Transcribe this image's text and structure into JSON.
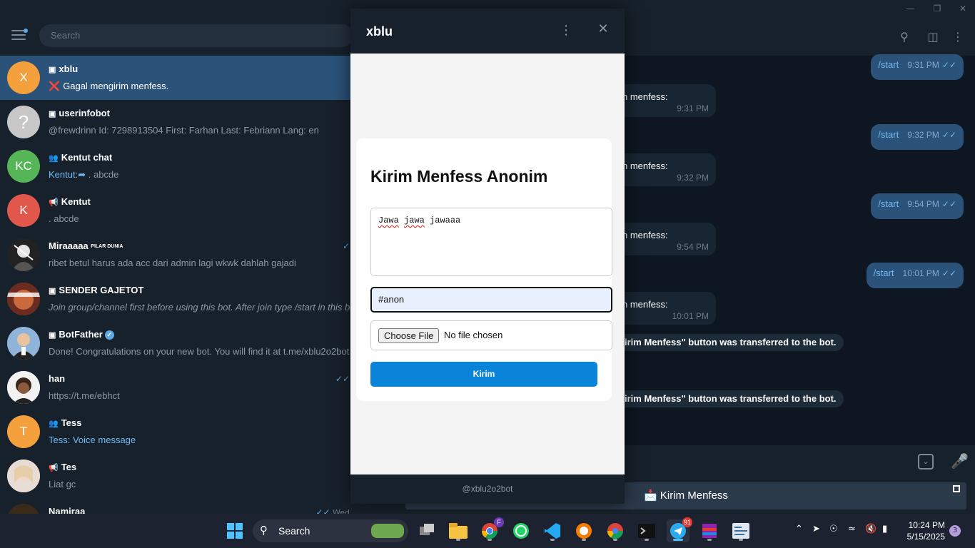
{
  "left": {
    "search_placeholder": "Search",
    "chats": [
      {
        "name": "xblu",
        "preview": "Gagal mengirim menfess.",
        "initial": "X",
        "color": "#f4a03c"
      },
      {
        "name": "userinfobot",
        "preview": "@frewdrinn Id: 7298913504 First: Farhan Last: Febriann Lang: en",
        "initial": "?",
        "color": "#c7c7c7"
      },
      {
        "name": "Kentut chat",
        "sender": "Kentut:",
        "preview": ". abcde",
        "initial": "KC",
        "color": "#56b657"
      },
      {
        "name": "Kentut",
        "preview": ". abcde",
        "initial": "K",
        "color": "#e2574c"
      },
      {
        "name": "Miraaaaa",
        "name_suffix": "PILAR DUNIA",
        "preview": "ribet betul harus ada acc dari admin lagi wkwk dahlah gajadi",
        "color": "#222222"
      },
      {
        "name": "SENDER GAJETOT",
        "preview": "Join group/channel first before using this bot.  After join type /start in this bot",
        "color": "#8a3a2a"
      },
      {
        "name": "BotFather",
        "preview": "Done! Congratulations on your new bot. You will find it at t.me/xblu2o2bot",
        "color": "#3b5b7a"
      },
      {
        "name": "han",
        "preview": "https://t.me/ebhct",
        "color": "#e0e0e0"
      },
      {
        "name": "Tess",
        "sender": "Tess:",
        "preview": "Voice message",
        "initial": "T",
        "color": "#f4a03c"
      },
      {
        "name": "Tes",
        "preview": "Liat gc",
        "color": "#d9c7c0"
      },
      {
        "name": "Namiraa",
        "time": "Wed",
        "color": "#3a2a1a"
      }
    ]
  },
  "messages": {
    "outgoing": [
      {
        "text": "/start",
        "time": "9:31 PM"
      },
      {
        "text": "/start",
        "time": "9:32 PM"
      },
      {
        "text": "/start",
        "time": "9:54 PM"
      },
      {
        "text": "/start",
        "time": "10:01 PM"
      }
    ],
    "incoming": [
      {
        "text": "n menfess:",
        "time": "9:31 PM"
      },
      {
        "text": "n menfess:",
        "time": "9:32 PM"
      },
      {
        "text": "n menfess:",
        "time": "9:54 PM"
      },
      {
        "text": "n menfess:",
        "time": "10:01 PM"
      }
    ],
    "service": [
      "irim Menfess\" button was transferred to the bot.",
      "irim Menfess\" button was transferred to the bot."
    ],
    "keyboard_button": "Kirim Menfess",
    "keyboard_icon": "envelope-icon"
  },
  "popup": {
    "title": "xblu",
    "form_title": "Kirim Menfess Anonim",
    "message_value": [
      "Jawa",
      " ",
      "jawa",
      " jawaaa"
    ],
    "tag_value": "#anon",
    "file_button": "Choose File",
    "file_status": "No file chosen",
    "submit_label": "Kirim",
    "footer": "@xblu2o2bot"
  },
  "taskbar": {
    "search_label": "Search",
    "chrome_badge": "F",
    "telegram_badge": "91",
    "time": "10:24 PM",
    "date": "5/15/2025",
    "notifications": "3"
  }
}
